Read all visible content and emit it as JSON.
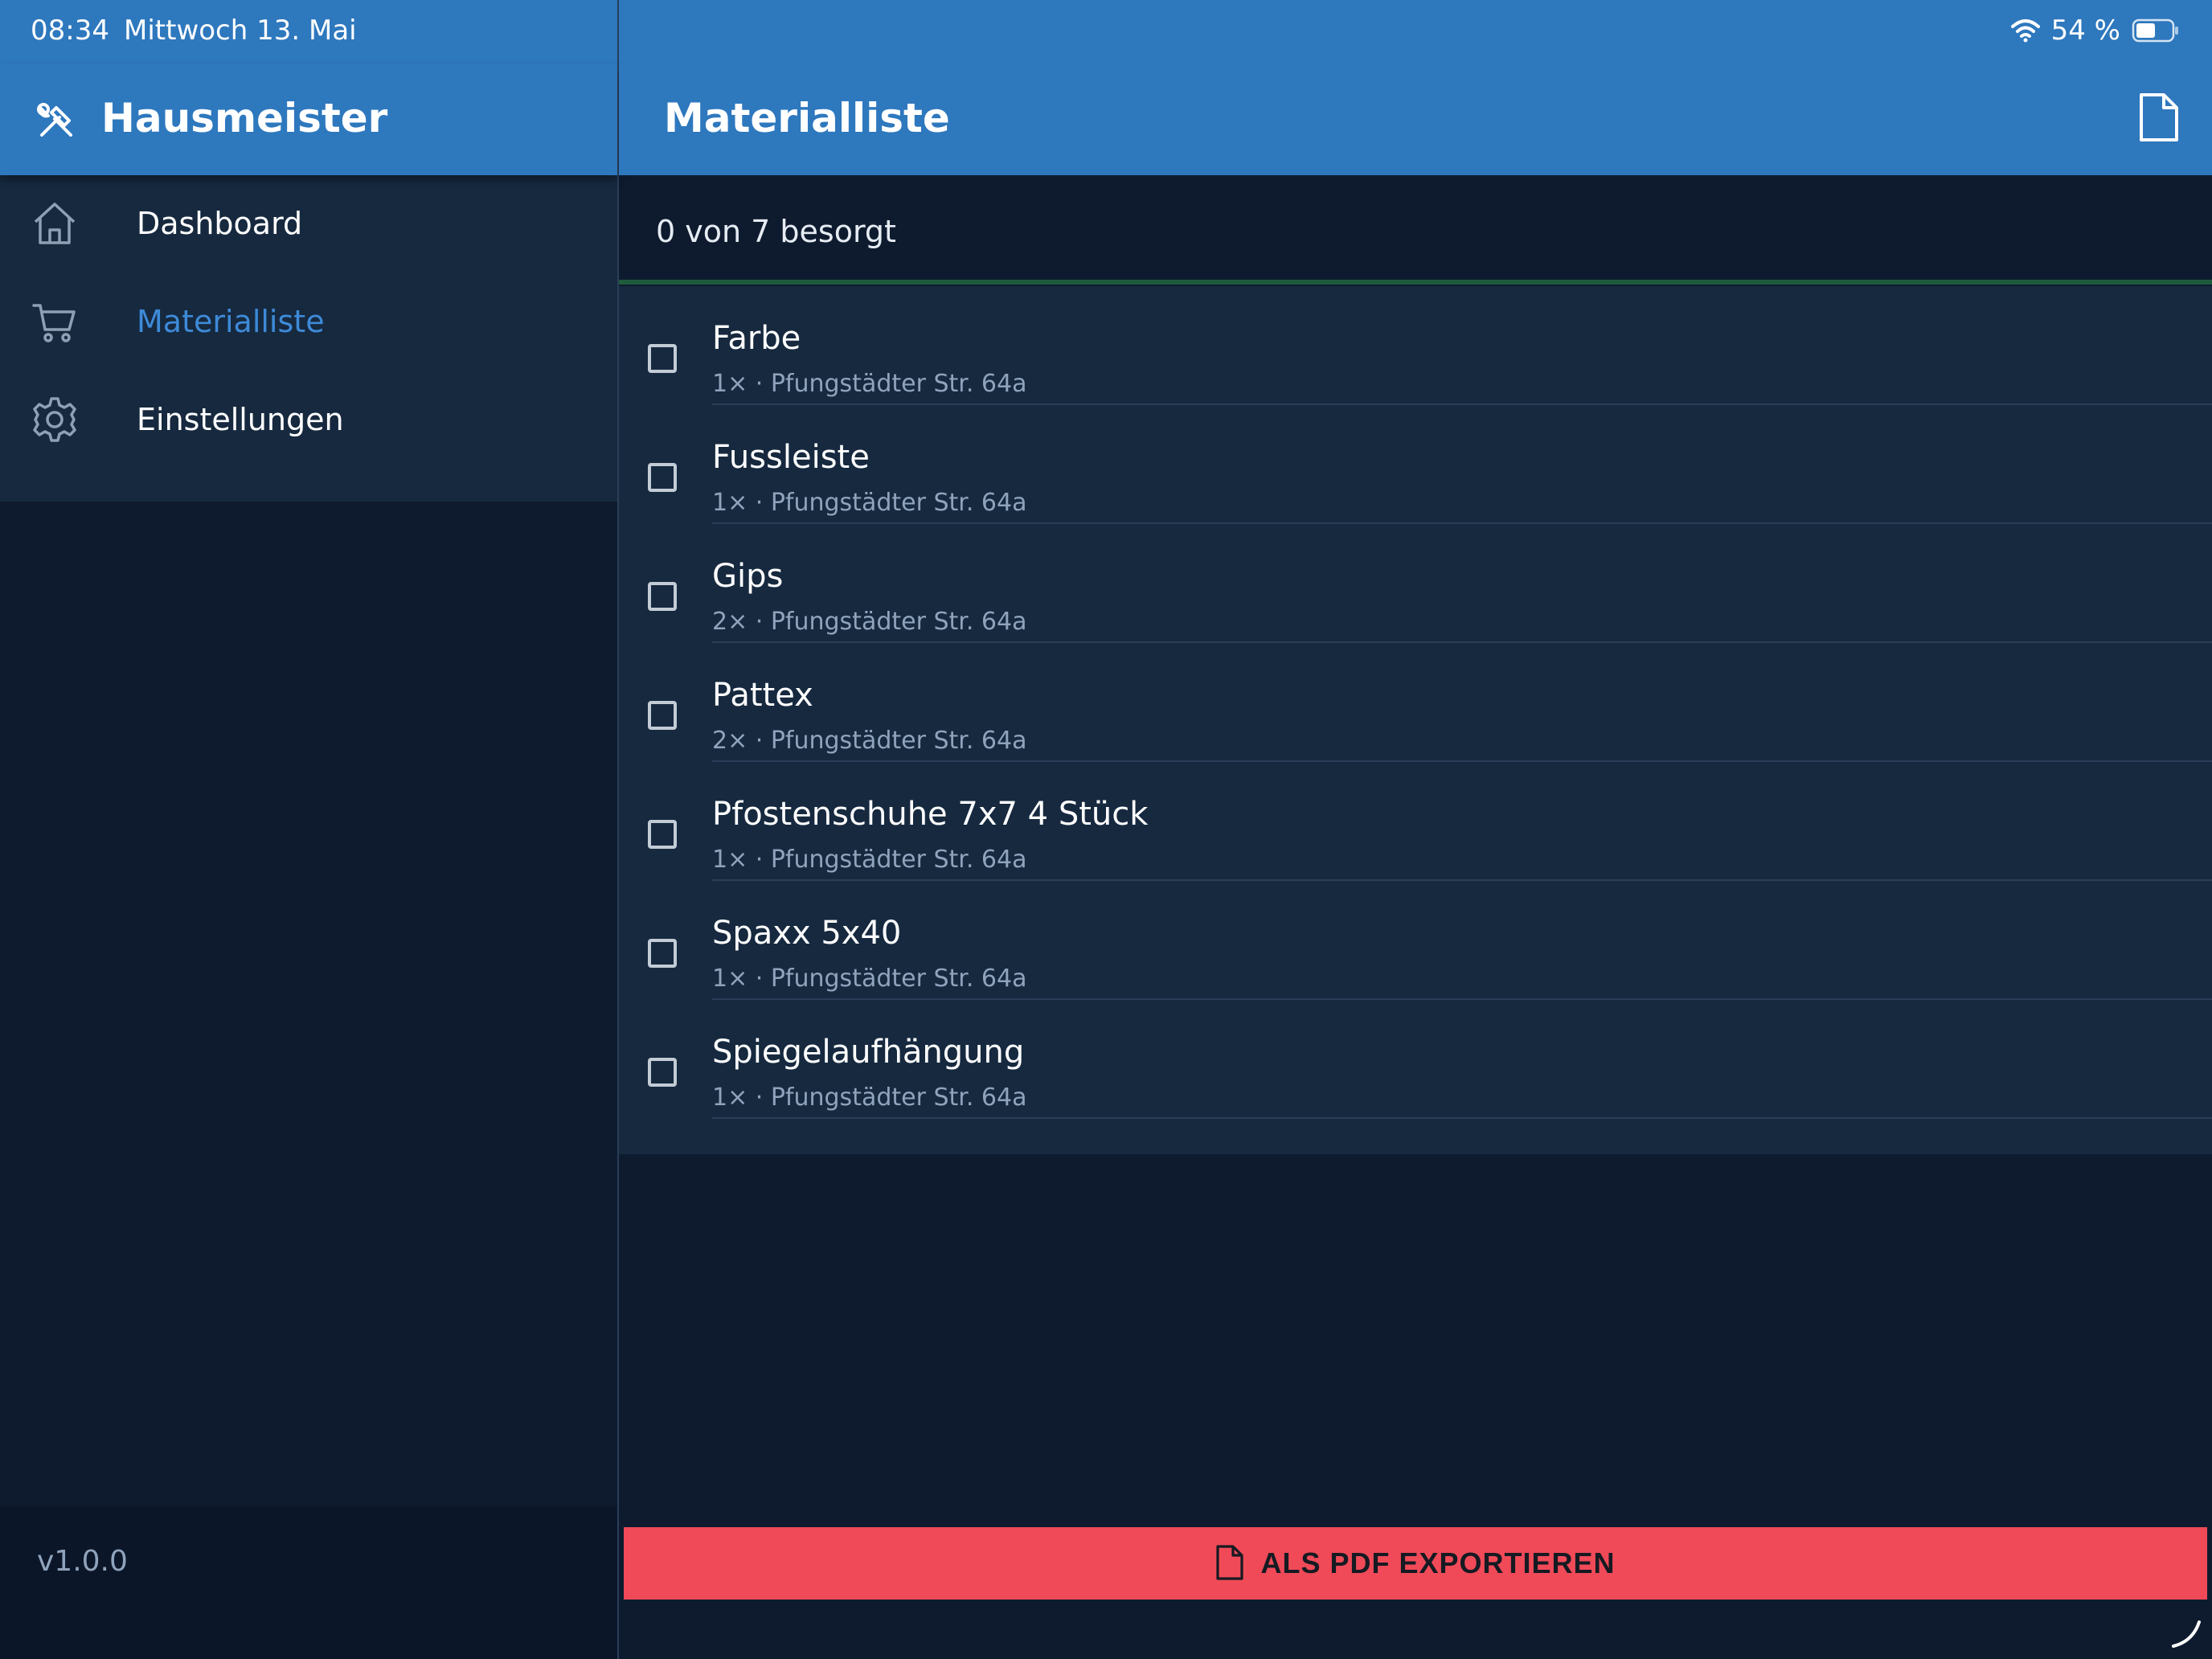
{
  "status_bar": {
    "time": "08:34",
    "date": "Mittwoch 13. Mai",
    "battery": "54 %",
    "battery_level": 0.54,
    "icons": [
      "wifi-icon",
      "battery-icon"
    ]
  },
  "sidebar": {
    "app_title": "Hausmeister",
    "logo_icon": "tools-icon",
    "items": [
      {
        "label": "Dashboard",
        "icon": "home-icon",
        "active": false
      },
      {
        "label": "Materialliste",
        "icon": "cart-icon",
        "active": true
      },
      {
        "label": "Einstellungen",
        "icon": "gear-icon",
        "active": false
      }
    ],
    "version": "v1.0.0"
  },
  "header": {
    "title": "Materialliste",
    "action_icon": "document-icon"
  },
  "progress": {
    "text": "0 von 7 besorgt",
    "done": 0,
    "total": 7
  },
  "items": [
    {
      "name": "Farbe",
      "meta": "1× · Pfungstädter Str. 64a",
      "checked": false
    },
    {
      "name": "Fussleiste",
      "meta": "1× · Pfungstädter Str. 64a",
      "checked": false
    },
    {
      "name": "Gips",
      "meta": "2× · Pfungstädter Str. 64a",
      "checked": false
    },
    {
      "name": "Pattex",
      "meta": "2× · Pfungstädter Str. 64a",
      "checked": false
    },
    {
      "name": "Pfostenschuhe 7x7 4 Stück",
      "meta": "1× · Pfungstädter Str. 64a",
      "checked": false
    },
    {
      "name": "Spaxx 5x40",
      "meta": "1× · Pfungstädter Str. 64a",
      "checked": false
    },
    {
      "name": "Spiegelaufhängung",
      "meta": "1× · Pfungstädter Str. 64a",
      "checked": false
    }
  ],
  "export": {
    "label": "ALS PDF EXPORTIEREN",
    "icon": "document-icon"
  },
  "colors": {
    "primary": "#2e78be",
    "background": "#0e1b2f",
    "surface": "#16293f",
    "active_nav": "#3e8ad8",
    "export_button": "#f04a58",
    "progress": "#2fa061"
  }
}
